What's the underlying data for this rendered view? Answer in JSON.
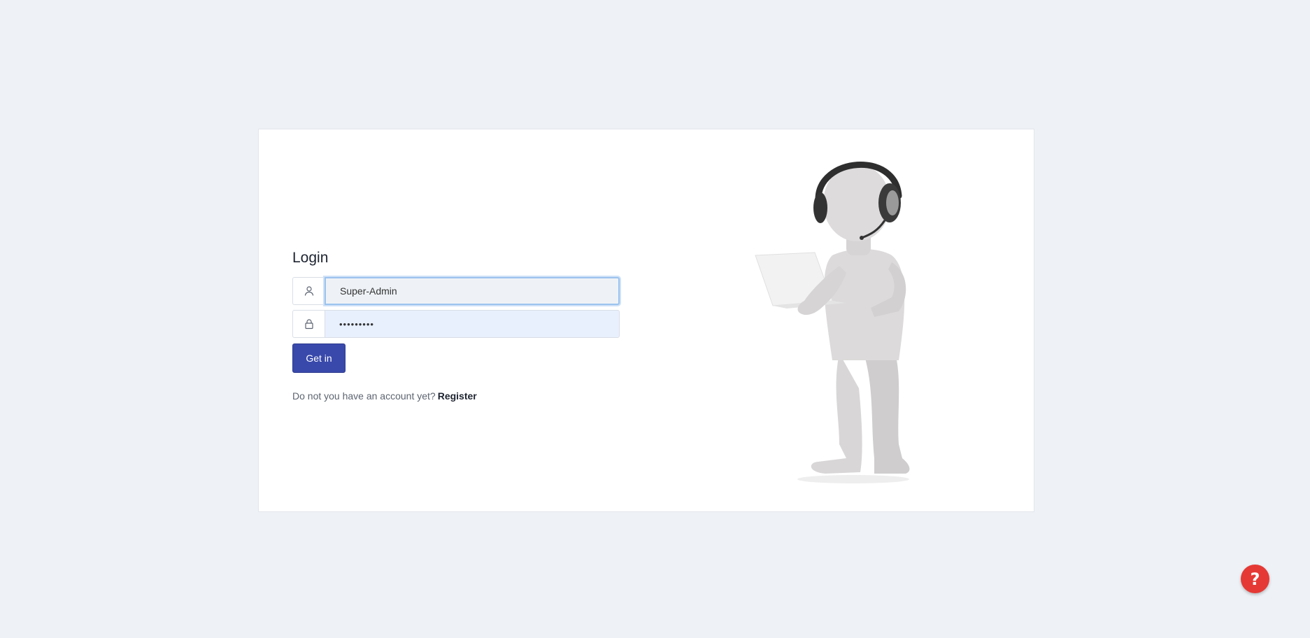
{
  "login": {
    "title": "Login",
    "username_value": "Super-Admin",
    "password_value": "•••••••••",
    "submit_label": "Get in",
    "register_prompt": "Do not you have an account yet?",
    "register_link": "Register"
  },
  "icons": {
    "username": "user-icon",
    "password": "lock-icon",
    "help": "question-mark-icon"
  },
  "colors": {
    "primary_button": "#3949ab",
    "help_button": "#e53935",
    "page_background": "#eef2f6"
  },
  "help": {
    "symbol": "?"
  }
}
